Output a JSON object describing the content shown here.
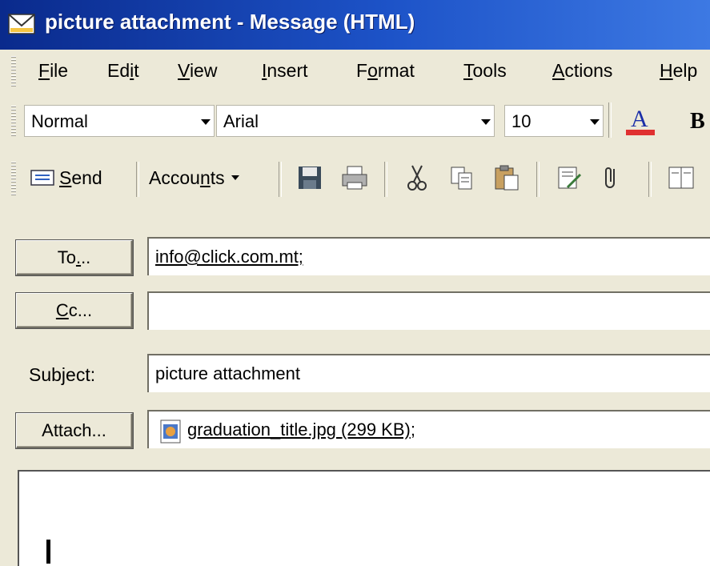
{
  "window": {
    "title": "picture attachment - Message (HTML)",
    "title_icon": "envelope-icon"
  },
  "menu": {
    "items": [
      {
        "label": "File",
        "accel": "F",
        "rest": "ile"
      },
      {
        "label": "Edit",
        "accel": "",
        "pre": "Ed",
        "accel_mid": "i",
        "post": "t"
      },
      {
        "label": "View",
        "accel": "V",
        "rest": "iew"
      },
      {
        "label": "Insert",
        "accel": "I",
        "rest": "nsert"
      },
      {
        "label": "Format",
        "pre": "F",
        "accel_mid": "o",
        "post": "rmat"
      },
      {
        "label": "Tools",
        "accel": "T",
        "rest": "ools"
      },
      {
        "label": "Actions",
        "accel": "A",
        "rest": "ctions"
      },
      {
        "label": "Help",
        "accel": "H",
        "rest": "elp"
      }
    ]
  },
  "formatting": {
    "style": "Normal",
    "font": "Arial",
    "size": "10",
    "font_color_icon": "font-color-icon",
    "bold_icon": "bold-icon",
    "font_color": "#e03030"
  },
  "toolbar": {
    "send_pre": "",
    "send_accel": "S",
    "send_post": "end",
    "accounts_pre": "Accou",
    "accounts_accel": "n",
    "accounts_post": "ts",
    "icons": [
      "save-icon",
      "print-icon",
      "cut-icon",
      "copy-icon",
      "paste-icon",
      "signature-icon",
      "attach-icon",
      "address-book-icon"
    ]
  },
  "header": {
    "to_pre": "To",
    "to_accel": ".",
    "to_post": "..",
    "to_value": "info@click.com.mt;",
    "cc_accel": "C",
    "cc_post": "c...",
    "cc_value": "",
    "subject_pre": "Subject:",
    "subject_value": "picture attachment",
    "attach_label": "Attach...",
    "attachment_name": "graduation_title.jpg (299 KB)",
    "attachment_suffix": ";"
  }
}
